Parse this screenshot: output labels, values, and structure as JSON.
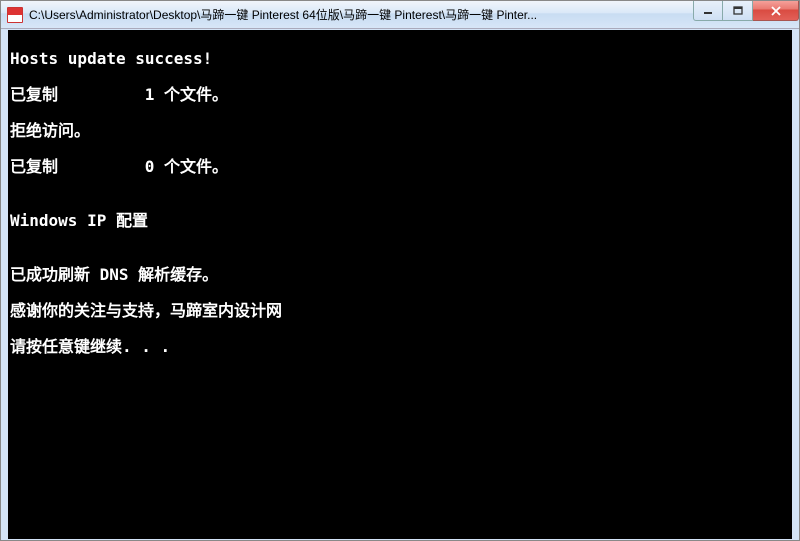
{
  "window": {
    "title": "C:\\Users\\Administrator\\Desktop\\马蹄一键 Pinterest 64位版\\马蹄一键 Pinterest\\马蹄一键 Pinter..."
  },
  "console": {
    "lines": [
      "Hosts update success!",
      "已复制         1 个文件。",
      "拒绝访问。",
      "已复制         0 个文件。",
      "",
      "Windows IP 配置",
      "",
      "已成功刷新 DNS 解析缓存。",
      "感谢你的关注与支持，马蹄室内设计网",
      "请按任意键继续. . ."
    ]
  }
}
